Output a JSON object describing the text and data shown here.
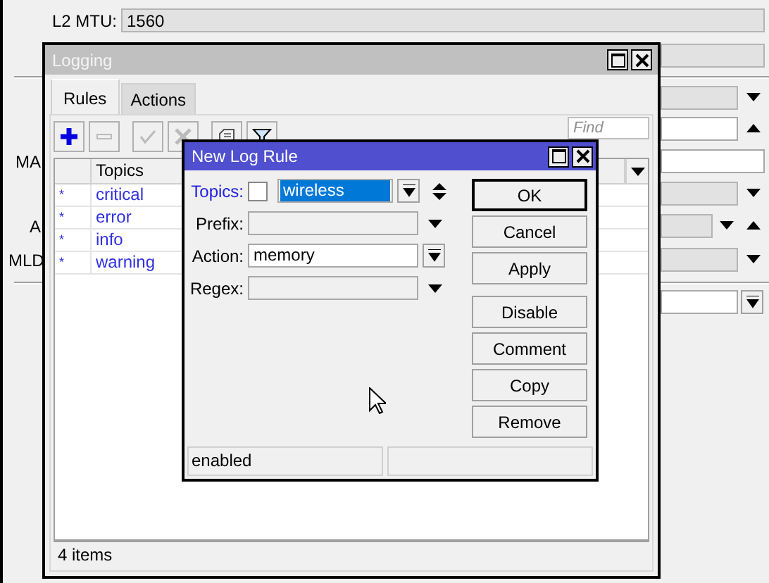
{
  "background_form": {
    "rows": [
      {
        "label": "L2 MTU:",
        "value": "1560",
        "disabled": true,
        "kind": "plain"
      },
      {
        "disabled": true,
        "kind": "plain"
      },
      {
        "disabled": true,
        "kind": "down"
      },
      {
        "disabled": false,
        "kind": "up"
      },
      {
        "label": "MA",
        "disabled": false,
        "kind": "plain"
      },
      {
        "disabled": true,
        "kind": "down"
      },
      {
        "label": "A",
        "disabled": true,
        "kind": "downup"
      },
      {
        "label": "MLD",
        "disabled": true,
        "kind": "down"
      },
      {
        "disabled": false,
        "kind": "menu"
      }
    ]
  },
  "logging_window": {
    "title": "Logging",
    "tabs": [
      {
        "label": "Rules",
        "selected": true
      },
      {
        "label": "Actions",
        "selected": false
      }
    ],
    "toolbar": [
      {
        "kind": "add",
        "disabled": false
      },
      {
        "kind": "remove",
        "disabled": true
      },
      {
        "kind": "enable",
        "disabled": true
      },
      {
        "kind": "disable",
        "disabled": true
      },
      {
        "kind": "comment",
        "disabled": false
      },
      {
        "kind": "filter",
        "disabled": false
      }
    ],
    "find": {
      "placeholder": "Find"
    },
    "table": {
      "columns": [
        "Topics"
      ],
      "rows": [
        {
          "marker": "*",
          "topics": "critical"
        },
        {
          "marker": "*",
          "topics": "error"
        },
        {
          "marker": "*",
          "topics": "info"
        },
        {
          "marker": "*",
          "topics": "warning"
        }
      ]
    },
    "status_bar": "4 items"
  },
  "dialog": {
    "title": "New Log Rule",
    "fields": [
      {
        "kind": "topics",
        "label": "Topics:",
        "checked": false,
        "value": "wireless",
        "focused": true
      },
      {
        "kind": "dropdown",
        "label": "Prefix:",
        "disabled": true
      },
      {
        "kind": "select",
        "label": "Action:",
        "value": "memory",
        "disabled": false
      },
      {
        "kind": "dropdown",
        "label": "Regex:",
        "disabled": true
      }
    ],
    "buttons": [
      {
        "label": "OK",
        "default": true
      },
      {
        "label": "Cancel",
        "default": false
      },
      {
        "label": "Apply",
        "default": false
      },
      {
        "label": "Disable",
        "default": false
      },
      {
        "label": "Comment",
        "default": false
      },
      {
        "label": "Copy",
        "default": false
      },
      {
        "label": "Remove",
        "default": false
      }
    ],
    "status_bar": "enabled"
  }
}
